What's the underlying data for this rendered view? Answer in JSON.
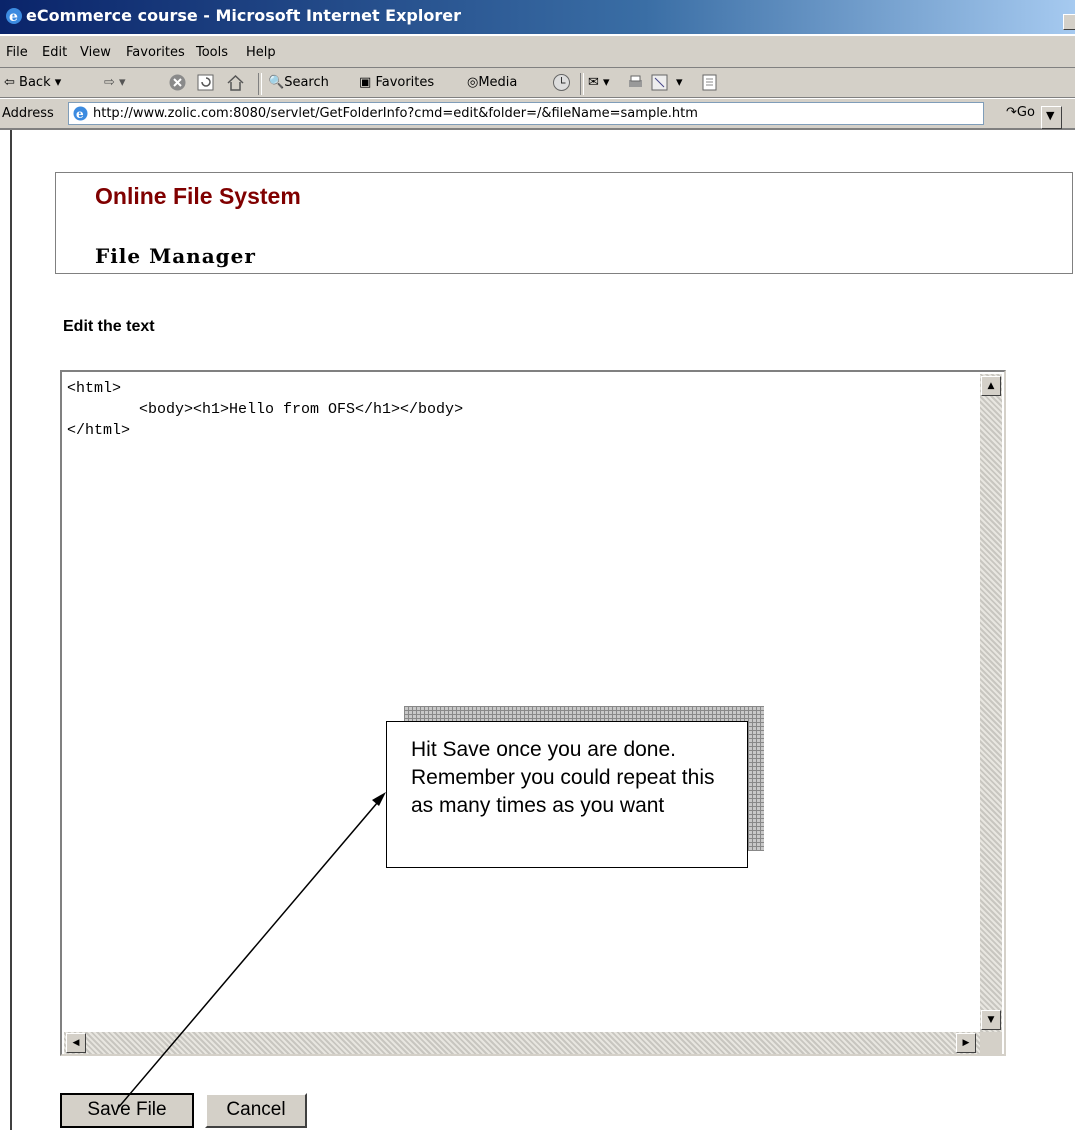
{
  "window": {
    "title": "eCommerce course - Microsoft Internet Explorer"
  },
  "menu": [
    "File",
    "Edit",
    "View",
    "Favorites",
    "Tools",
    "Help"
  ],
  "toolbar": {
    "back": "Back",
    "search": "Search",
    "favorites": "Favorites",
    "media": "Media"
  },
  "address": {
    "label": "Address",
    "url": "http://www.zolic.com:8080/servlet/GetFolderInfo?cmd=edit&folder=/&fileName=sample.htm",
    "go": "Go"
  },
  "page": {
    "site_title": "Online File System",
    "section_title": "File Manager",
    "edit_label": "Edit the text",
    "code": "<html>\n        <body><h1>Hello from OFS</h1></body>\n</html>",
    "save_button": "Save File",
    "cancel_button": "Cancel"
  },
  "callout": {
    "text": "Hit Save once you are done. Remember you could repeat this as many times as you want"
  },
  "colors": {
    "site_title": "#800000",
    "chrome": "#d4d0c8",
    "titlebar": "#0a246a"
  }
}
